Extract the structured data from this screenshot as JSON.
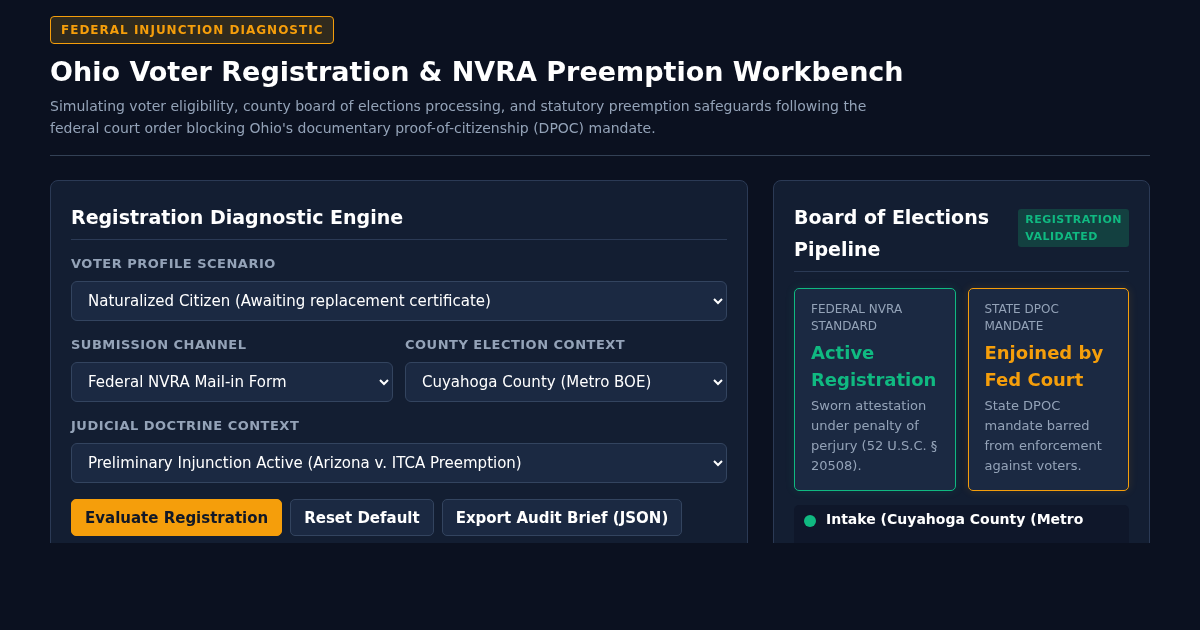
{
  "badge": "FEDERAL INJUNCTION DIAGNOSTIC",
  "title": "Ohio Voter Registration & NVRA Preemption Workbench",
  "subtitle": "Simulating voter eligibility, county board of elections processing, and statutory preemption safeguards following the federal court order blocking Ohio's documentary proof-of-citizenship (DPOC) mandate.",
  "engine": {
    "title": "Registration Diagnostic Engine",
    "fields": [
      {
        "label": "VOTER PROFILE SCENARIO",
        "value": "Naturalized Citizen (Awaiting replacement certificate)",
        "kind": "full"
      },
      {
        "label": "SUBMISSION CHANNEL",
        "value": "Federal NVRA Mail-in Form",
        "kind": "half"
      },
      {
        "label": "COUNTY ELECTION CONTEXT",
        "value": "Cuyahoga County (Metro BOE)",
        "kind": "half"
      },
      {
        "label": "JUDICIAL DOCTRINE CONTEXT",
        "value": "Preliminary Injunction Active (Arizona v. ITCA Preemption)",
        "kind": "full"
      }
    ],
    "buttons": [
      {
        "label": "Evaluate Registration",
        "kind": "primary"
      },
      {
        "label": "Reset Default",
        "kind": "secondary"
      },
      {
        "label": "Export Audit Brief (JSON)",
        "kind": "secondary"
      }
    ]
  },
  "pipeline": {
    "title": "Board of Elections Pipeline",
    "status": "REGISTRATION VALIDATED",
    "cards": [
      {
        "heading": "FEDERAL NVRA STANDARD",
        "result": "Active Registration",
        "note": "Sworn attestation under penalty of perjury (52 U.S.C. § 20508).",
        "color": "#10b981"
      },
      {
        "heading": "STATE DPOC MANDATE",
        "result": "Enjoined by Fed Court",
        "note": "State DPOC mandate barred from enforcement against voters.",
        "color": "#f59e0b"
      }
    ],
    "steps": [
      {
        "title": "Intake (Cuyahoga County (Metro"
      }
    ]
  }
}
